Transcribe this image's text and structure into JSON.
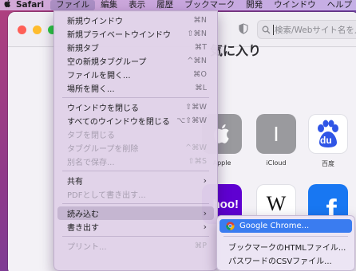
{
  "menubar": {
    "app": "Safari",
    "items": [
      "ファイル",
      "編集",
      "表示",
      "履歴",
      "ブックマーク",
      "開発",
      "ウインドウ",
      "ヘルプ"
    ]
  },
  "toolbar": {
    "search_placeholder": "検索/Webサイト名を入力"
  },
  "favorites": {
    "title": "気に入り",
    "tiles": [
      {
        "label": "Apple",
        "icon": "apple-logo-icon"
      },
      {
        "label": "iCloud",
        "letter": "I"
      },
      {
        "label": "百度",
        "letter": "du"
      },
      {
        "label": "",
        "letter": "hoo!"
      },
      {
        "label": "",
        "letter": "W"
      },
      {
        "label": "",
        "letter": "f"
      }
    ]
  },
  "file_menu": {
    "items": [
      {
        "label": "新規ウインドウ",
        "shortcut": "⌘N"
      },
      {
        "label": "新規プライベートウインドウ",
        "shortcut": "⇧⌘N"
      },
      {
        "label": "新規タブ",
        "shortcut": "⌘T"
      },
      {
        "label": "空の新規タブグループ",
        "shortcut": "^⌘N"
      },
      {
        "label": "ファイルを開く...",
        "shortcut": "⌘O"
      },
      {
        "label": "場所を開く...",
        "shortcut": "⌘L"
      },
      {
        "label": "ウインドウを閉じる",
        "shortcut": "⇧⌘W"
      },
      {
        "label": "すべてのウインドウを閉じる",
        "shortcut": "⌥⇧⌘W"
      },
      {
        "label": "タブを閉じる",
        "shortcut": ""
      },
      {
        "label": "タブグループを削除",
        "shortcut": "^⌘W"
      },
      {
        "label": "別名で保存...",
        "shortcut": "⇧⌘S"
      },
      {
        "label": "共有",
        "shortcut": ""
      },
      {
        "label": "PDFとして書き出す...",
        "shortcut": ""
      },
      {
        "label": "読み込む",
        "shortcut": ""
      },
      {
        "label": "書き出す",
        "shortcut": ""
      },
      {
        "label": "プリント...",
        "shortcut": "⌘P"
      }
    ]
  },
  "import_submenu": {
    "items": [
      {
        "label": "Google Chrome..."
      },
      {
        "label": "ブックマークのHTMLファイル..."
      },
      {
        "label": "パスワードのCSVファイル..."
      }
    ]
  },
  "colors": {
    "accent": "#3a7cf0",
    "traffic_red": "#fe5f57",
    "traffic_yellow": "#febc2e",
    "traffic_green": "#28c840",
    "baidu_blue": "#2f55e6",
    "facebook_blue": "#1877f2",
    "yahoo_purple": "#5f01d1"
  }
}
